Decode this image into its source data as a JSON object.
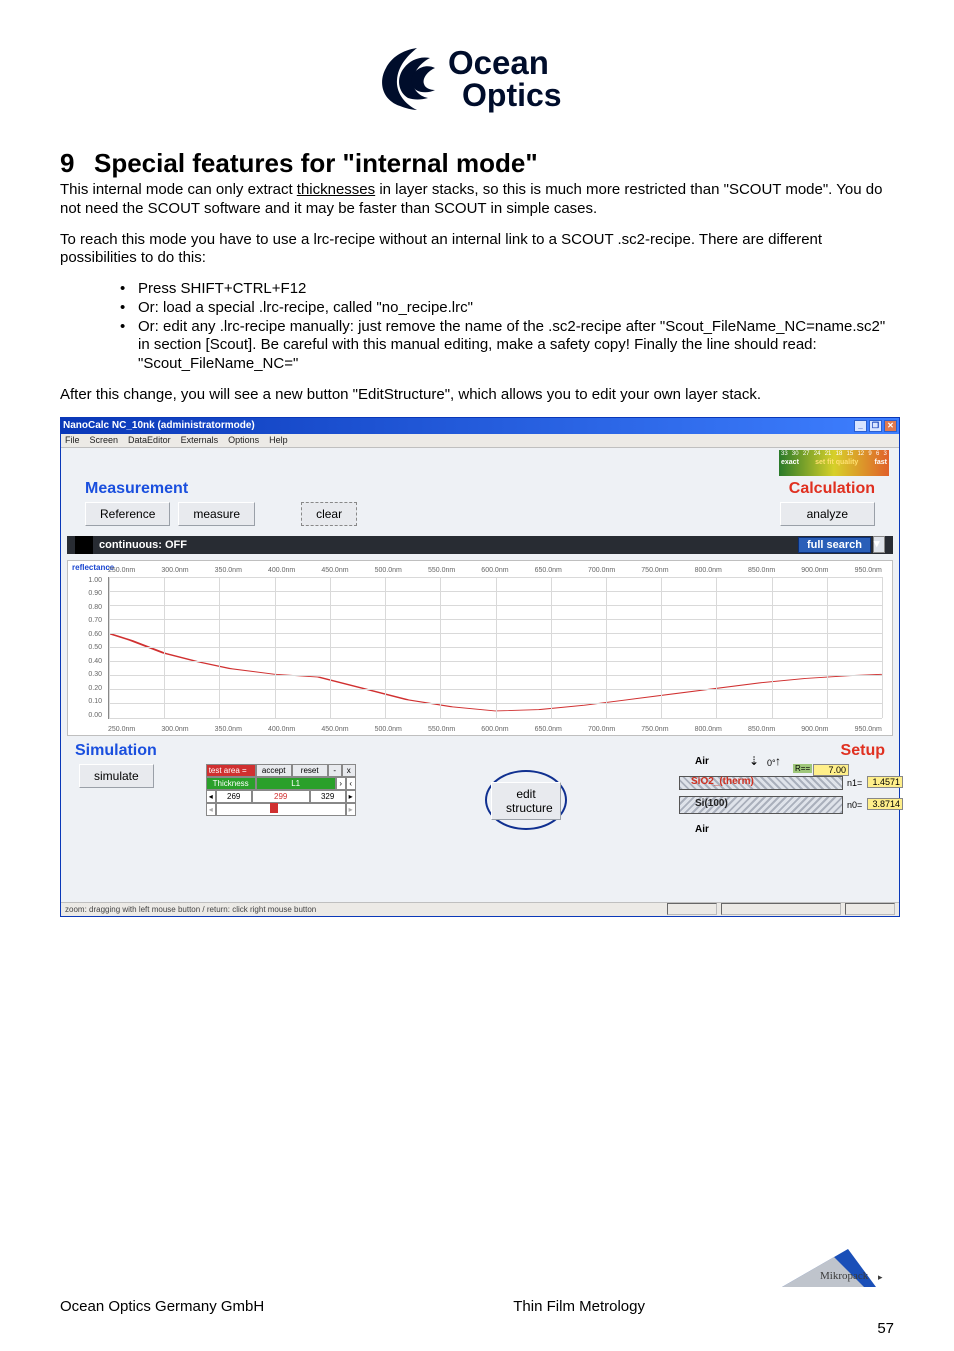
{
  "logo": {
    "line1": "Ocean",
    "line2": "Optics"
  },
  "heading": {
    "num": "9",
    "title": "Special features for \"internal mode\""
  },
  "para1_a": "This internal mode can only extract ",
  "para1_underlined": "thicknesses",
  "para1_b": " in layer stacks, so this is much more restricted than \"SCOUT mode\". You do not need the SCOUT software and it may be faster than SCOUT in simple cases.",
  "para2": "To reach this mode you have to use a lrc-recipe without an internal link to a SCOUT .sc2-recipe. There are different possibilities to do this:",
  "bullets": [
    "Press SHIFT+CTRL+F12",
    "Or:  load a special .lrc-recipe, called \"no_recipe.lrc\"",
    "Or:  edit any .lrc-recipe manually: just remove the name of the .sc2-recipe after \"Scout_FileName_NC=name.sc2\" in section [Scout]. Be careful with this manual editing, make a safety copy! Finally the line should read: \"Scout_FileName_NC=\""
  ],
  "para3": "After this change, you will see a new button \"EditStructure\", which allows you to edit your own layer stack.",
  "app": {
    "title": "NanoCalc NC_10nk  (administratormode)",
    "menus": [
      "File",
      "Screen",
      "DataEditor",
      "Externals",
      "Options",
      "Help"
    ],
    "quality": {
      "ticks": [
        "33",
        "30",
        "27",
        "24",
        "21",
        "18",
        "15",
        "12",
        "9",
        "6",
        "3"
      ],
      "left": "exact",
      "mid": "set fit quality",
      "right": "fast"
    },
    "measurement": {
      "title": "Measurement",
      "reference": "Reference",
      "measure": "measure",
      "clear": "clear",
      "continuous": "continuous:  OFF"
    },
    "calculation": {
      "title": "Calculation",
      "analyze": "analyze",
      "fullsearch": "full search"
    },
    "simulation": {
      "title": "Simulation",
      "simulate": "simulate",
      "setup": "Setup",
      "edit_structure": "edit structure",
      "thickness": {
        "h_left": "test area =",
        "h_acc": "accept",
        "h_res": "reset",
        "h_x": "x",
        "row_label": "Thickness",
        "row_l1": "L1",
        "v_left": "269",
        "v_mid": "299",
        "v_right": "329"
      },
      "stack": {
        "air_top": "Air",
        "layer1": "SiO2_(therm)",
        "layer2": "Si(100)",
        "air_bottom": "Air",
        "angle": "0°",
        "R_label": "R==",
        "R_val": "7.00",
        "n1_label": "n1=",
        "n1_val": "1.4571",
        "n0_label": "n0=",
        "n0_val": "3.8714"
      }
    },
    "status": "zoom: dragging with left mouse button  /  return: click right mouse button"
  },
  "chart_data": {
    "type": "line",
    "title": "reflectance",
    "xlabel": "nm",
    "ylabel": "reflectance",
    "x_ticks": [
      "250.0nm",
      "300.0nm",
      "350.0nm",
      "400.0nm",
      "450.0nm",
      "500.0nm",
      "550.0nm",
      "600.0nm",
      "650.0nm",
      "700.0nm",
      "750.0nm",
      "800.0nm",
      "850.0nm",
      "900.0nm",
      "950.0nm"
    ],
    "y_ticks": [
      "1.00",
      "0.90",
      "0.80",
      "0.70",
      "0.60",
      "0.50",
      "0.40",
      "0.30",
      "0.20",
      "0.10",
      "0.00"
    ],
    "xlim": [
      250,
      950
    ],
    "ylim": [
      0,
      1.0
    ],
    "x": [
      250,
      270,
      300,
      330,
      360,
      400,
      440,
      480,
      520,
      560,
      600,
      640,
      680,
      720,
      760,
      800,
      840,
      880,
      920,
      950
    ],
    "values": [
      0.6,
      0.55,
      0.46,
      0.4,
      0.35,
      0.31,
      0.29,
      0.21,
      0.13,
      0.08,
      0.05,
      0.06,
      0.09,
      0.13,
      0.17,
      0.21,
      0.25,
      0.28,
      0.3,
      0.31
    ]
  },
  "footer": {
    "left": "Ocean Optics Germany GmbH",
    "mid": "Thin Film Metrology",
    "page": "57",
    "mikro": "Mikropack"
  }
}
